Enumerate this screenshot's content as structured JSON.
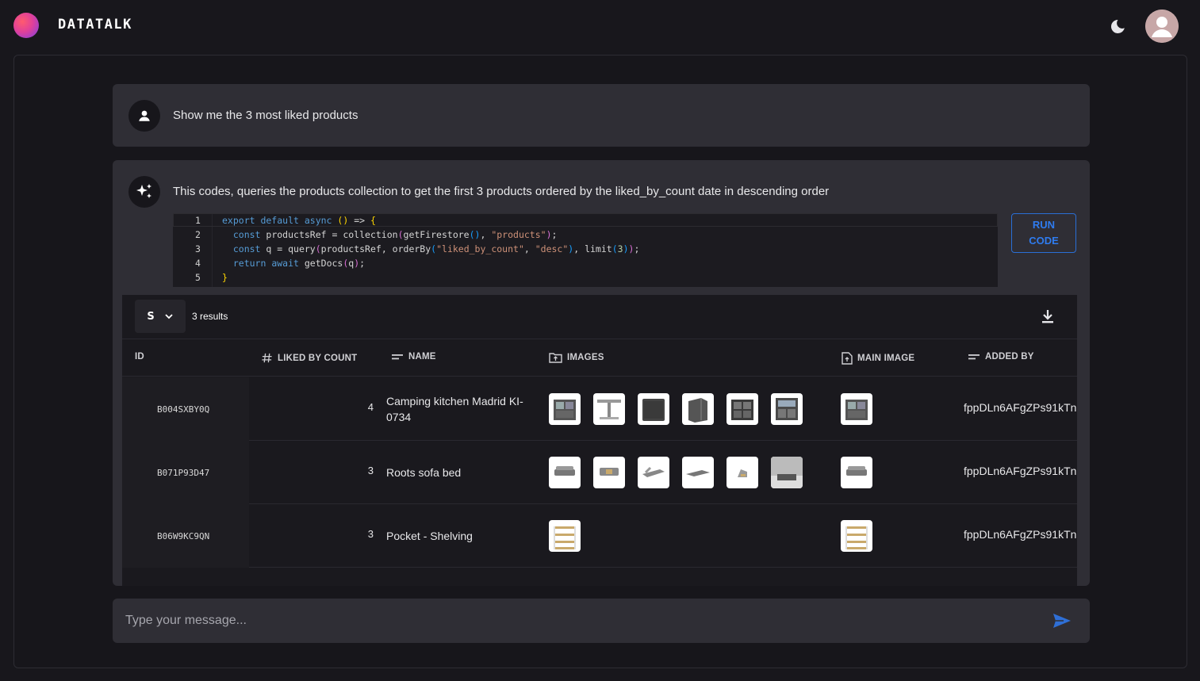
{
  "app": {
    "title": "DATATALK"
  },
  "user_message": {
    "text": "Show me the 3 most liked products"
  },
  "bot_message": {
    "text": "This codes, queries the products collection to get the first 3 products ordered by the liked_by_count date in descending order",
    "run_label_1": "RUN",
    "run_label_2": "CODE"
  },
  "code_lines": [
    {
      "n": "1",
      "text": "export default async () => {"
    },
    {
      "n": "2",
      "text": "  const productsRef = collection(getFirestore(), \"products\");"
    },
    {
      "n": "3",
      "text": "  const q = query(productsRef, orderBy(\"liked_by_count\", \"desc\"), limit(3));"
    },
    {
      "n": "4",
      "text": "  return await getDocs(q);"
    },
    {
      "n": "5",
      "text": "}"
    }
  ],
  "grid": {
    "size_selector": "S",
    "result_count": "3 results",
    "columns": [
      "ID",
      "LIKED BY COUNT",
      "NAME",
      "IMAGES",
      "MAIN IMAGE",
      "ADDED BY"
    ],
    "rows": [
      {
        "id": "B004SXBY0Q",
        "liked_by_count": "4",
        "name": "Camping kitchen Madrid KI-0734",
        "added_by": "fppDLn6AFgZPs91kTn",
        "image_count": 6
      },
      {
        "id": "B071P93D47",
        "liked_by_count": "3",
        "name": "Roots sofa bed",
        "added_by": "fppDLn6AFgZPs91kTn",
        "image_count": 6
      },
      {
        "id": "B06W9KC9QN",
        "liked_by_count": "3",
        "name": "Pocket - Shelving",
        "added_by": "fppDLn6AFgZPs91kTn",
        "image_count": 1
      }
    ]
  },
  "composer": {
    "placeholder": "Type your message..."
  },
  "colors": {
    "accent": "#2f7cf0",
    "background": "#18171c",
    "card": "#2f2e35"
  }
}
